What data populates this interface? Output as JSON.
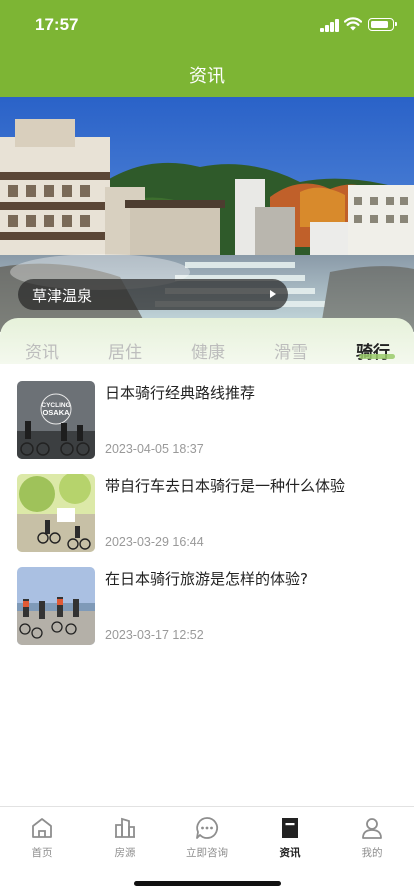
{
  "status_bar": {
    "time": "17:57"
  },
  "header": {
    "title": "资讯"
  },
  "banner": {
    "caption": "草津温泉"
  },
  "tabs": [
    {
      "label": "资讯",
      "active": false
    },
    {
      "label": "居住",
      "active": false
    },
    {
      "label": "健康",
      "active": false
    },
    {
      "label": "滑雪",
      "active": false
    },
    {
      "label": "骑行",
      "active": true
    }
  ],
  "articles": [
    {
      "title": "日本骑行经典路线推荐",
      "date": "2023-04-05 18:37",
      "thumb_text": [
        "CYCLING",
        "OSAKA"
      ]
    },
    {
      "title": "带自行车去日本骑行是一种什么体验",
      "date": "2023-03-29 16:44"
    },
    {
      "title": "在日本骑行旅游是怎样的体验?",
      "date": "2023-03-17 12:52"
    }
  ],
  "tabbar": [
    {
      "label": "首页",
      "icon": "home-icon",
      "active": false
    },
    {
      "label": "房源",
      "icon": "building-icon",
      "active": false
    },
    {
      "label": "立即咨询",
      "icon": "chat-icon",
      "active": false
    },
    {
      "label": "资讯",
      "icon": "news-icon",
      "active": true
    },
    {
      "label": "我的",
      "icon": "user-icon",
      "active": false
    }
  ],
  "colors": {
    "accent": "#7db534",
    "tab_active": "#222222",
    "tab_inactive": "#bdbdbd"
  }
}
